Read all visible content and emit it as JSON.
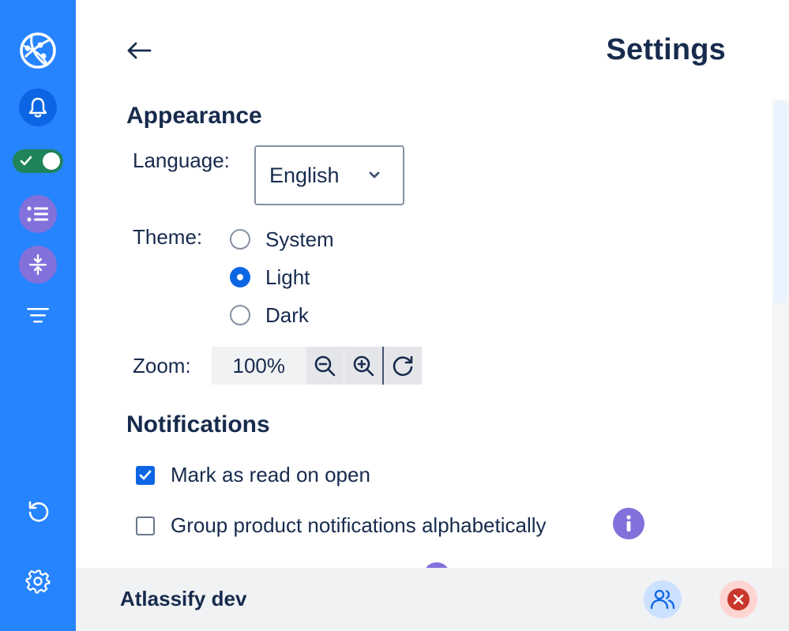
{
  "header": {
    "title": "Settings"
  },
  "appearance": {
    "title": "Appearance",
    "language": {
      "label": "Language:",
      "value": "English"
    },
    "theme": {
      "label": "Theme:",
      "options": [
        "System",
        "Light",
        "Dark"
      ],
      "selected": "Light"
    },
    "zoom": {
      "label": "Zoom:",
      "value": "100%"
    }
  },
  "notifications": {
    "title": "Notifications",
    "items": [
      {
        "label": "Mark as read on open",
        "checked": true
      },
      {
        "label": "Group product notifications alphabetically",
        "checked": false
      }
    ]
  },
  "footer": {
    "title": "Atlassify dev"
  },
  "colors": {
    "sidebar": "#2684ff",
    "primary": "#0c66e4",
    "text": "#172b4d",
    "toggle_on": "#1f845a",
    "discovery": "#8270db",
    "danger": "#c9372c",
    "footer_bg": "#f1f2f4"
  },
  "icons": {
    "sidebar": [
      "atlassify-logo-icon",
      "bell-icon",
      "toggle-switch",
      "list-icon",
      "collapse-icon",
      "filter-icon",
      "refresh-icon",
      "gear-icon"
    ],
    "main": [
      "arrow-left-icon",
      "chevron-down-icon",
      "zoom-out-icon",
      "zoom-in-icon",
      "zoom-reset-icon",
      "info-icon"
    ],
    "footer": [
      "people-icon",
      "close-circle-icon"
    ]
  }
}
